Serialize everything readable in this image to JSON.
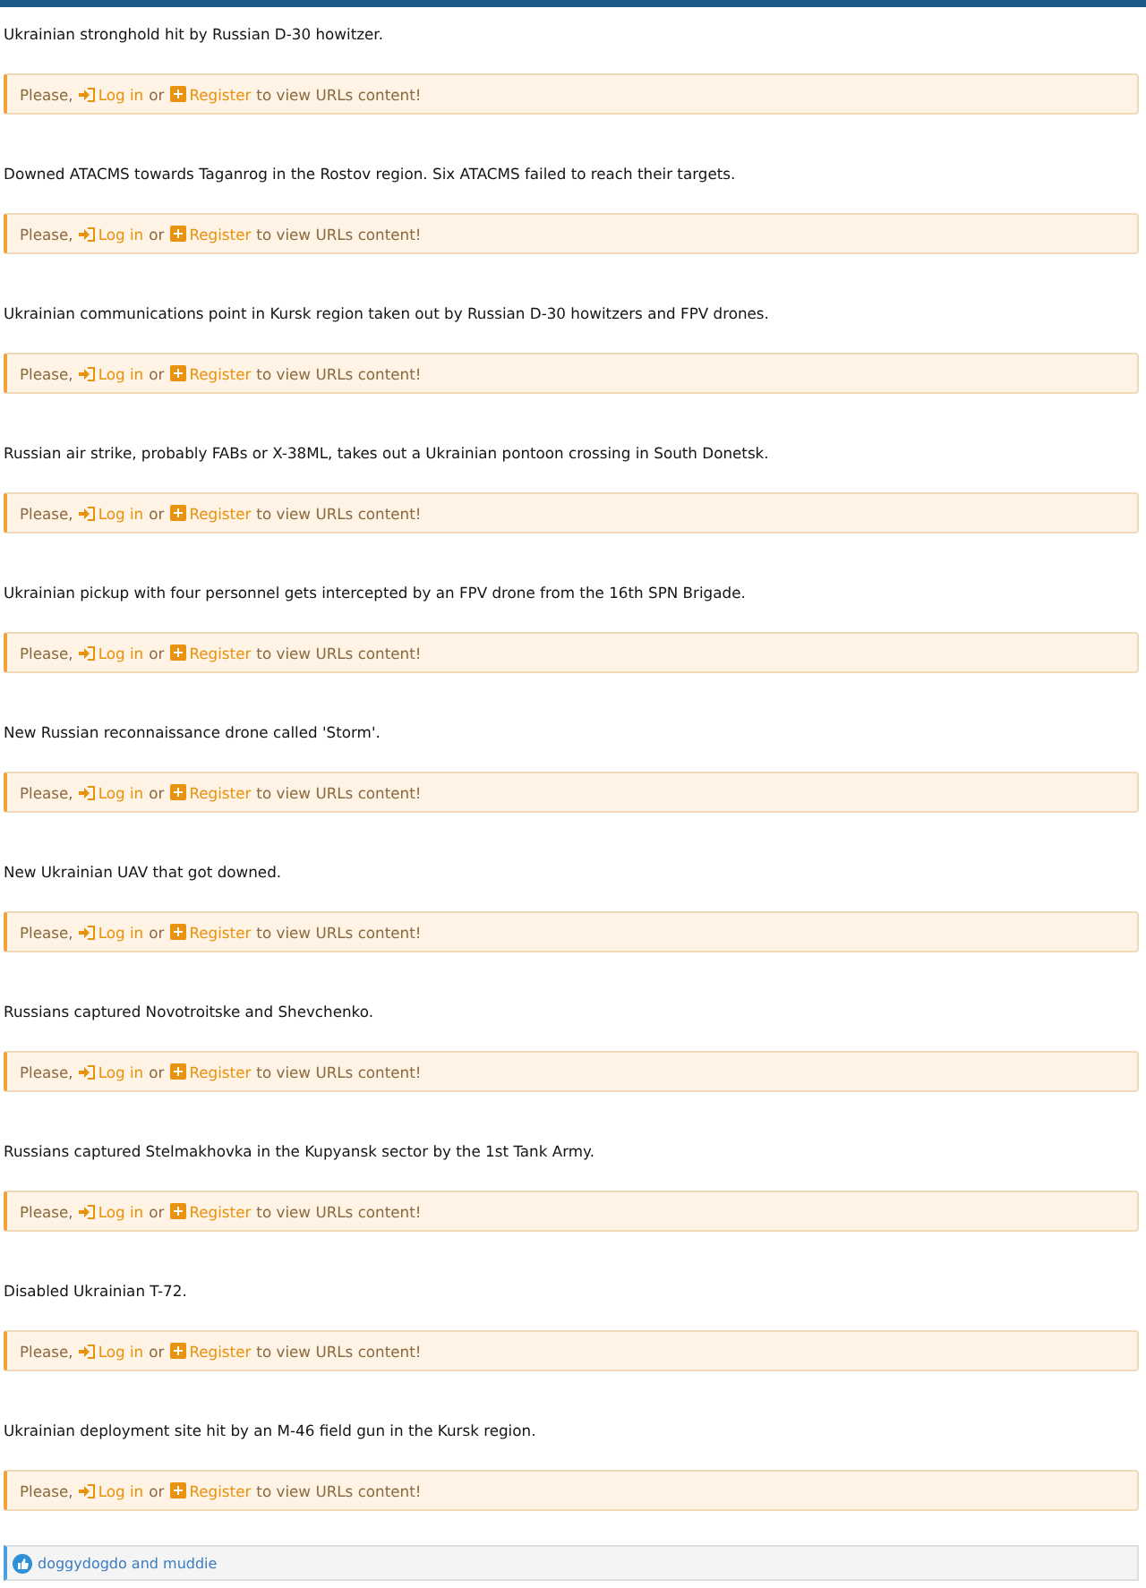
{
  "posts": [
    {
      "caption": "Ukrainian stronghold hit by Russian D-30 howitzer.",
      "notice": {
        "prefix": "Please,",
        "login": "Log in",
        "or": "or",
        "register": "Register",
        "suffix": "to view URLs content!"
      }
    },
    {
      "caption": "Downed ATACMS towards Taganrog in the Rostov region. Six ATACMS failed to reach their targets.",
      "notice": {
        "prefix": "Please,",
        "login": "Log in",
        "or": "or",
        "register": "Register",
        "suffix": "to view URLs content!"
      }
    },
    {
      "caption": "Ukrainian communications point in Kursk region taken out by Russian D-30 howitzers and FPV drones.",
      "notice": {
        "prefix": "Please,",
        "login": "Log in",
        "or": "or",
        "register": "Register",
        "suffix": "to view URLs content!"
      }
    },
    {
      "caption": "Russian air strike, probably FABs or X-38ML, takes out a Ukrainian pontoon crossing in South Donetsk.",
      "notice": {
        "prefix": "Please,",
        "login": "Log in",
        "or": "or",
        "register": "Register",
        "suffix": "to view URLs content!"
      }
    },
    {
      "caption": "Ukrainian pickup with four personnel gets intercepted by an FPV drone from the 16th SPN Brigade.",
      "notice": {
        "prefix": "Please,",
        "login": "Log in",
        "or": "or",
        "register": "Register",
        "suffix": "to view URLs content!"
      }
    },
    {
      "caption": "New Russian reconnaissance drone called 'Storm'.",
      "notice": {
        "prefix": "Please,",
        "login": "Log in",
        "or": "or",
        "register": "Register",
        "suffix": "to view URLs content!"
      }
    },
    {
      "caption": "New Ukrainian UAV that got downed.",
      "notice": {
        "prefix": "Please,",
        "login": "Log in",
        "or": "or",
        "register": "Register",
        "suffix": "to view URLs content!"
      }
    },
    {
      "caption": "Russians captured Novotroitske and Shevchenko.",
      "notice": {
        "prefix": "Please,",
        "login": "Log in",
        "or": "or",
        "register": "Register",
        "suffix": "to view URLs content!"
      }
    },
    {
      "caption": "Russians captured Stelmakhovka in the Kupyansk sector by the 1st Tank Army.",
      "notice": {
        "prefix": "Please,",
        "login": "Log in",
        "or": "or",
        "register": "Register",
        "suffix": "to view URLs content!"
      }
    },
    {
      "caption": "Disabled Ukrainian T-72.",
      "notice": {
        "prefix": "Please,",
        "login": "Log in",
        "or": "or",
        "register": "Register",
        "suffix": "to view URLs content!"
      }
    },
    {
      "caption": "Ukrainian deployment site hit by an M-46 field gun in the Kursk region.",
      "notice": {
        "prefix": "Please,",
        "login": "Log in",
        "or": "or",
        "register": "Register",
        "suffix": "to view URLs content!"
      }
    }
  ],
  "reactions": {
    "text": "doggydogdo and muddie"
  }
}
